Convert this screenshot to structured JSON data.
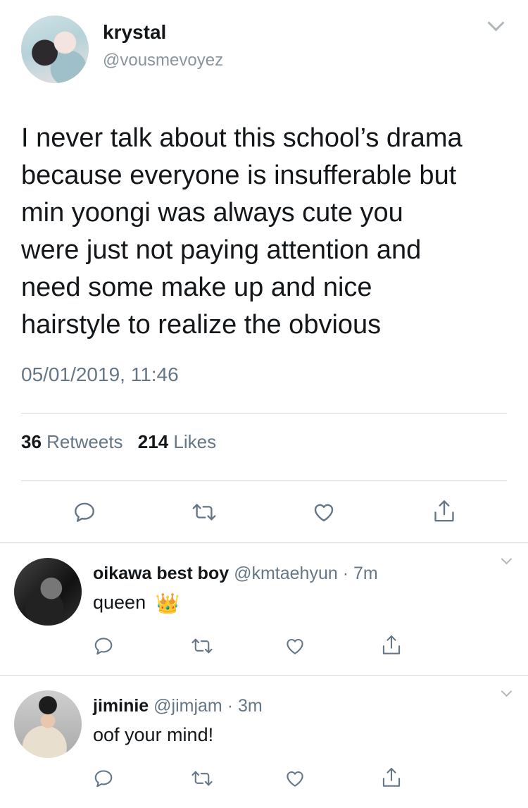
{
  "main_tweet": {
    "display_name": "krystal",
    "handle": "@vousmevoyez",
    "text_lines": [
      "I never talk about this school’s drama",
      "because everyone is insufferable but",
      "min yoongi was always cute you",
      "were just not paying attention and",
      "need some make up and nice",
      "hairstyle to realize the obvious"
    ],
    "timestamp": "05/01/2019, 11:46",
    "retweet_count": "36",
    "retweet_label": "Retweets",
    "like_count": "214",
    "like_label": "Likes",
    "actions": [
      "reply-icon",
      "retweet-icon",
      "like-icon",
      "share-icon"
    ]
  },
  "replies": [
    {
      "display_name": "oikawa best boy",
      "handle": "@kmtaehyun",
      "separator": "·",
      "time": "7m",
      "text": "queen",
      "emoji": "👑",
      "actions": [
        "reply-icon",
        "retweet-icon",
        "like-icon",
        "share-icon"
      ]
    },
    {
      "display_name": "jiminie",
      "handle": "@jimjam",
      "separator": "·",
      "time": "3m",
      "text": "oof your mind!",
      "actions": [
        "reply-icon",
        "retweet-icon",
        "like-icon",
        "share-icon"
      ]
    }
  ],
  "colors": {
    "text_primary": "#14171a",
    "text_secondary": "#657786",
    "divider": "#d4d9dd"
  }
}
